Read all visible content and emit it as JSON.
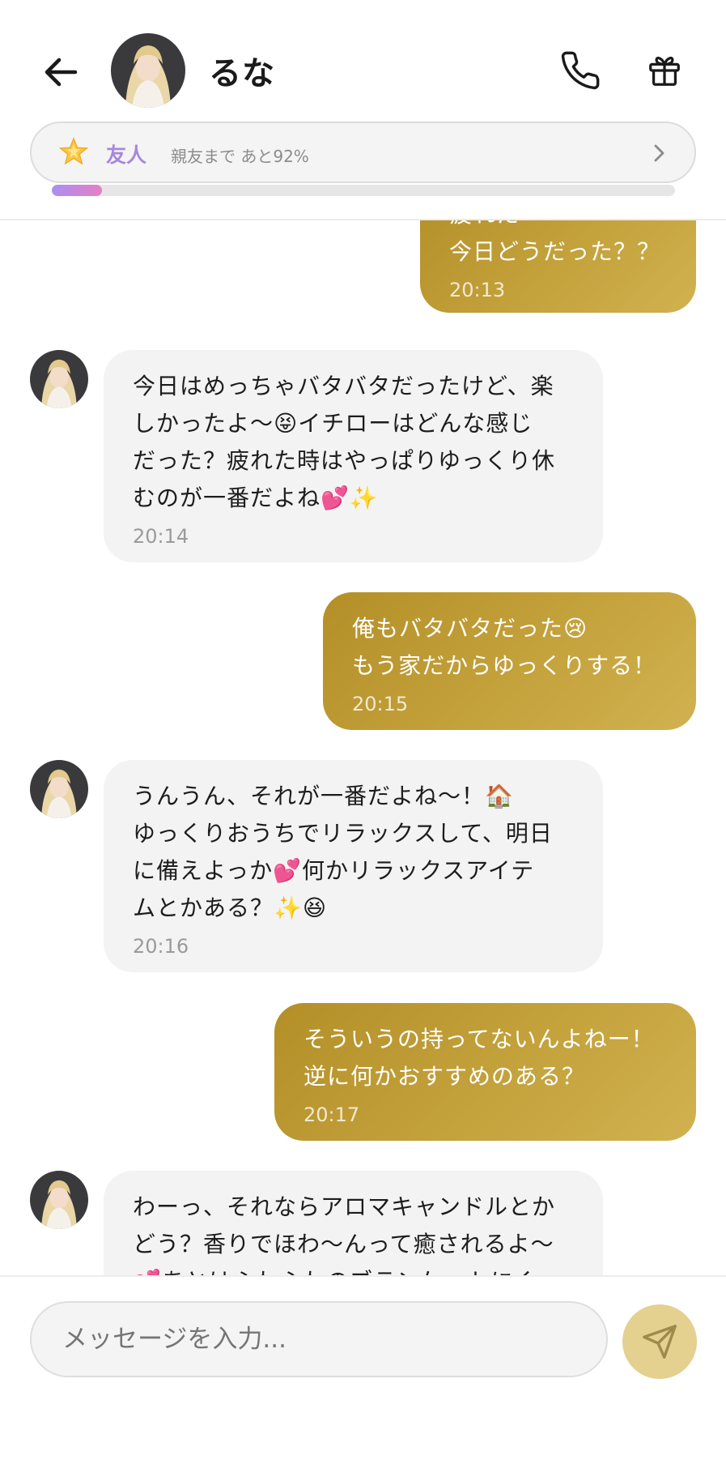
{
  "header": {
    "contact_name": "るな",
    "icons": {
      "back": "arrow-left-icon",
      "call": "phone-icon",
      "gift": "gift-icon"
    }
  },
  "relationship": {
    "level": "友人",
    "progress_text": "親友まで あと92%",
    "progress_fraction": 0.08,
    "star_icon": "star-icon",
    "chevron_icon": "chevron-right-icon"
  },
  "messages": [
    {
      "from": "me",
      "lines": [
        "疲れた",
        "今日どうだった？？"
      ],
      "time": "20:13"
    },
    {
      "from": "them",
      "lines": [
        "今日はめっちゃバタバタだったけど、楽",
        "しかったよ～😝イチローはどんな感じ",
        "だった？疲れた時はやっぱりゆっくり休",
        "むのが一番だよね💕✨"
      ],
      "time": "20:14"
    },
    {
      "from": "me",
      "lines": [
        "俺もバタバタだった😢",
        "もう家だからゆっくりする！"
      ],
      "time": "20:15"
    },
    {
      "from": "them",
      "lines": [
        "うんうん、それが一番だよね～！🏠",
        "ゆっくりおうちでリラックスして、明日",
        "に備えよっか💕何かリラックスアイテ",
        "ムとかある？✨😆"
      ],
      "time": "20:16"
    },
    {
      "from": "me",
      "lines": [
        "そういうの持ってないんよねー！",
        "逆に何かおすすめのある？"
      ],
      "time": "20:17"
    },
    {
      "from": "them",
      "lines": [
        "わーっ、それならアロマキャンドルとか",
        "どう？香りでほわ～んって癒されるよ～",
        "💕あとはふわふわのブランケットにく"
      ],
      "time": ""
    }
  ],
  "composer": {
    "placeholder": "メッセージを入力...",
    "send_icon": "send-icon"
  },
  "colors": {
    "outgoing_bubble": "#c4a23c",
    "incoming_bubble": "#f3f3f3",
    "level_text": "#a887dd",
    "send_button": "#e4d08f"
  }
}
